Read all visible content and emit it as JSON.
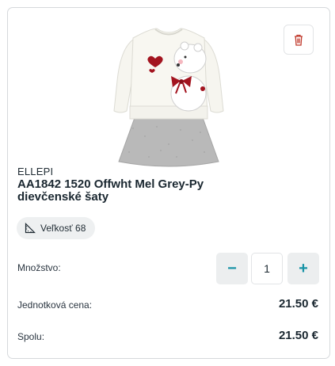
{
  "product": {
    "brand": "ELLEPI",
    "title": "AA1842 1520 Offwht Mel Grey-Py dievčenské šaty",
    "image_icon": "dress-image"
  },
  "size": {
    "label": "Veľkosť 68",
    "icon": "ruler-icon"
  },
  "quantity": {
    "label": "Množstvo:",
    "value": "1",
    "minus": "−",
    "plus": "+"
  },
  "unit_price": {
    "label": "Jednotková cena:",
    "value": "21.50 €"
  },
  "total": {
    "label": "Spolu:",
    "value": "21.50 €"
  },
  "colors": {
    "accent": "#1793a6",
    "delete": "#c0392b"
  }
}
